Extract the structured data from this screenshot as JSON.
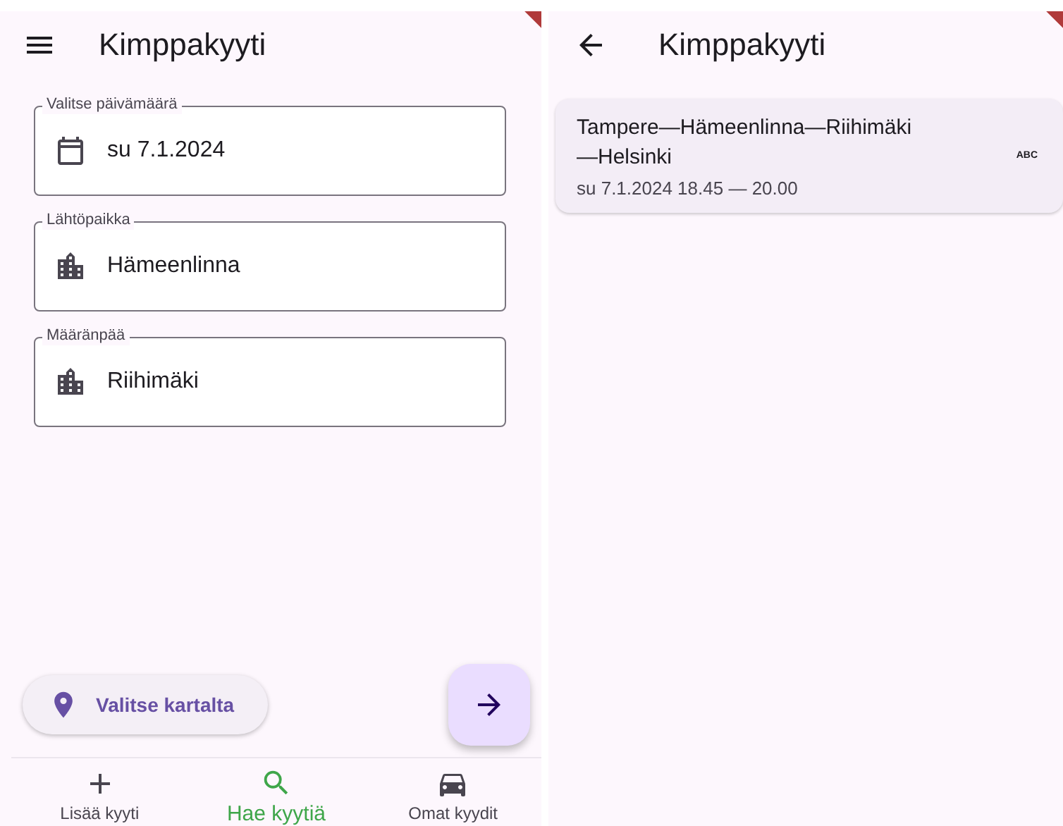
{
  "search_screen": {
    "title": "Kimppakyyti",
    "fields": [
      {
        "label": "Valitse päivämäärä",
        "value": "su 7.1.2024",
        "kind": "date"
      },
      {
        "label": "Lähtöpaikka",
        "value": "Hämeenlinna",
        "kind": "place"
      },
      {
        "label": "Määränpää",
        "value": "Riihimäki",
        "kind": "place"
      }
    ],
    "map_button": "Valitse kartalta",
    "nav": [
      {
        "label": "Lisää kyyti",
        "kind": "add",
        "selected": false
      },
      {
        "label": "Hae kyytiä",
        "kind": "search",
        "selected": true
      },
      {
        "label": "Omat kyydit",
        "kind": "car",
        "selected": false
      }
    ]
  },
  "results_screen": {
    "title": "Kimppakyyti",
    "rides": [
      {
        "route": "Tampere—Hämeenlinna—Riihimäki —Helsinki",
        "time": "su 7.1.2024 18.45 — 20.00",
        "badge": "ABC"
      }
    ]
  }
}
